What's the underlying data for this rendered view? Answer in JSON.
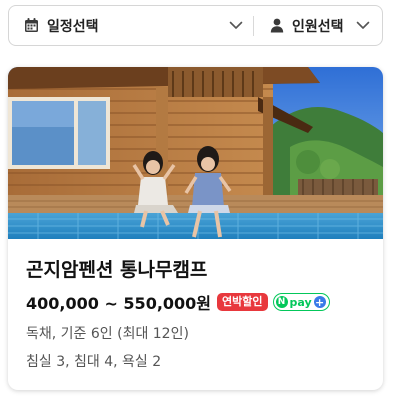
{
  "filters": {
    "date_label": "일정선택",
    "date_icon": "calendar-icon",
    "people_label": "인원선택",
    "people_icon": "person-icon",
    "chevron_icon": "chevron-down-icon"
  },
  "listing": {
    "name": "곤지암펜션 통나무캠프",
    "price": "400,000 ~ 550,000원",
    "badges": {
      "discount": "연박할인",
      "npay_n": "N",
      "npay_text": "pay",
      "npay_plus": "+"
    },
    "details": [
      "독채, 기준 6인 (최대 12인)",
      "침실 3, 침대 4, 욕실 2"
    ],
    "colors": {
      "discount_badge": "#e8383d",
      "npay_green": "#03c75a",
      "npay_plus_blue": "#3a7ae8"
    }
  }
}
